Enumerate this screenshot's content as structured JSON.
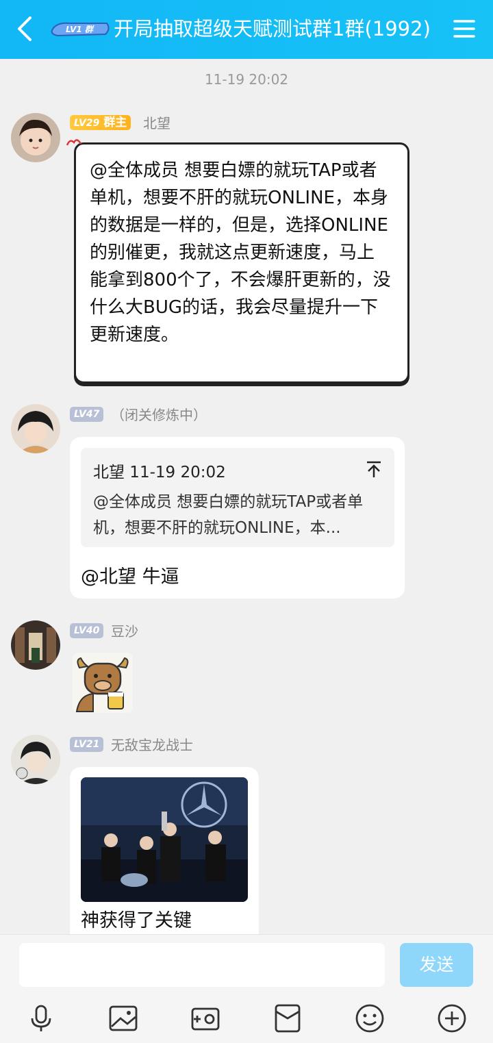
{
  "header": {
    "title": "开局抽取超级天赋测试群1群(1992)"
  },
  "chat": {
    "timestamp": "11-19 20:02",
    "messages": [
      {
        "level": "LV29",
        "role": "群主",
        "nickname": "北望",
        "text": "@全体成员 想要白嫖的就玩TAP或者单机，想要不肝的就玩ONLINE，本身的数据是一样的，但是，选择ONLINE的别催更，我就这点更新速度，马上能拿到800个了，不会爆肝更新的，没什么大BUG的话，我会尽量提升一下更新速度。"
      },
      {
        "level": "LV47",
        "nickname": "（闭关修炼中）",
        "quote_header": "北望 11-19 20:02",
        "quote_text": "@全体成员 想要白嫖的就玩TAP或者单机，想要不肝的就玩ONLINE，本...",
        "text": "@北望 牛逼"
      },
      {
        "level": "LV40",
        "nickname": "豆沙"
      },
      {
        "level": "LV21",
        "nickname": "无敌宝龙战士",
        "text": "神获得了关键"
      }
    ]
  },
  "composer": {
    "send_label": "发送",
    "input_value": ""
  },
  "colors": {
    "header": "#12b7f5",
    "send_disabled": "#8fd6fb"
  }
}
